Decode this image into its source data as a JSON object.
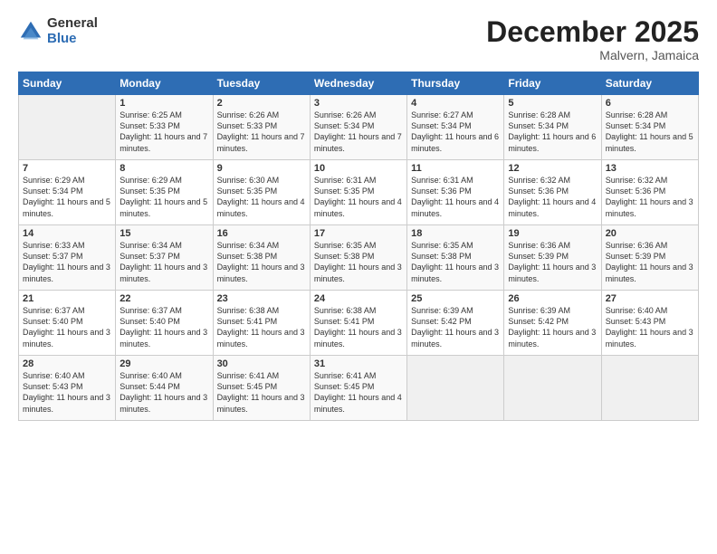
{
  "logo": {
    "general": "General",
    "blue": "Blue"
  },
  "header": {
    "month": "December 2025",
    "location": "Malvern, Jamaica"
  },
  "weekdays": [
    "Sunday",
    "Monday",
    "Tuesday",
    "Wednesday",
    "Thursday",
    "Friday",
    "Saturday"
  ],
  "weeks": [
    [
      {
        "day": "",
        "sunrise": "",
        "sunset": "",
        "daylight": ""
      },
      {
        "day": "1",
        "sunrise": "Sunrise: 6:25 AM",
        "sunset": "Sunset: 5:33 PM",
        "daylight": "Daylight: 11 hours and 7 minutes."
      },
      {
        "day": "2",
        "sunrise": "Sunrise: 6:26 AM",
        "sunset": "Sunset: 5:33 PM",
        "daylight": "Daylight: 11 hours and 7 minutes."
      },
      {
        "day": "3",
        "sunrise": "Sunrise: 6:26 AM",
        "sunset": "Sunset: 5:34 PM",
        "daylight": "Daylight: 11 hours and 7 minutes."
      },
      {
        "day": "4",
        "sunrise": "Sunrise: 6:27 AM",
        "sunset": "Sunset: 5:34 PM",
        "daylight": "Daylight: 11 hours and 6 minutes."
      },
      {
        "day": "5",
        "sunrise": "Sunrise: 6:28 AM",
        "sunset": "Sunset: 5:34 PM",
        "daylight": "Daylight: 11 hours and 6 minutes."
      },
      {
        "day": "6",
        "sunrise": "Sunrise: 6:28 AM",
        "sunset": "Sunset: 5:34 PM",
        "daylight": "Daylight: 11 hours and 5 minutes."
      }
    ],
    [
      {
        "day": "7",
        "sunrise": "Sunrise: 6:29 AM",
        "sunset": "Sunset: 5:34 PM",
        "daylight": "Daylight: 11 hours and 5 minutes."
      },
      {
        "day": "8",
        "sunrise": "Sunrise: 6:29 AM",
        "sunset": "Sunset: 5:35 PM",
        "daylight": "Daylight: 11 hours and 5 minutes."
      },
      {
        "day": "9",
        "sunrise": "Sunrise: 6:30 AM",
        "sunset": "Sunset: 5:35 PM",
        "daylight": "Daylight: 11 hours and 4 minutes."
      },
      {
        "day": "10",
        "sunrise": "Sunrise: 6:31 AM",
        "sunset": "Sunset: 5:35 PM",
        "daylight": "Daylight: 11 hours and 4 minutes."
      },
      {
        "day": "11",
        "sunrise": "Sunrise: 6:31 AM",
        "sunset": "Sunset: 5:36 PM",
        "daylight": "Daylight: 11 hours and 4 minutes."
      },
      {
        "day": "12",
        "sunrise": "Sunrise: 6:32 AM",
        "sunset": "Sunset: 5:36 PM",
        "daylight": "Daylight: 11 hours and 4 minutes."
      },
      {
        "day": "13",
        "sunrise": "Sunrise: 6:32 AM",
        "sunset": "Sunset: 5:36 PM",
        "daylight": "Daylight: 11 hours and 3 minutes."
      }
    ],
    [
      {
        "day": "14",
        "sunrise": "Sunrise: 6:33 AM",
        "sunset": "Sunset: 5:37 PM",
        "daylight": "Daylight: 11 hours and 3 minutes."
      },
      {
        "day": "15",
        "sunrise": "Sunrise: 6:34 AM",
        "sunset": "Sunset: 5:37 PM",
        "daylight": "Daylight: 11 hours and 3 minutes."
      },
      {
        "day": "16",
        "sunrise": "Sunrise: 6:34 AM",
        "sunset": "Sunset: 5:38 PM",
        "daylight": "Daylight: 11 hours and 3 minutes."
      },
      {
        "day": "17",
        "sunrise": "Sunrise: 6:35 AM",
        "sunset": "Sunset: 5:38 PM",
        "daylight": "Daylight: 11 hours and 3 minutes."
      },
      {
        "day": "18",
        "sunrise": "Sunrise: 6:35 AM",
        "sunset": "Sunset: 5:38 PM",
        "daylight": "Daylight: 11 hours and 3 minutes."
      },
      {
        "day": "19",
        "sunrise": "Sunrise: 6:36 AM",
        "sunset": "Sunset: 5:39 PM",
        "daylight": "Daylight: 11 hours and 3 minutes."
      },
      {
        "day": "20",
        "sunrise": "Sunrise: 6:36 AM",
        "sunset": "Sunset: 5:39 PM",
        "daylight": "Daylight: 11 hours and 3 minutes."
      }
    ],
    [
      {
        "day": "21",
        "sunrise": "Sunrise: 6:37 AM",
        "sunset": "Sunset: 5:40 PM",
        "daylight": "Daylight: 11 hours and 3 minutes."
      },
      {
        "day": "22",
        "sunrise": "Sunrise: 6:37 AM",
        "sunset": "Sunset: 5:40 PM",
        "daylight": "Daylight: 11 hours and 3 minutes."
      },
      {
        "day": "23",
        "sunrise": "Sunrise: 6:38 AM",
        "sunset": "Sunset: 5:41 PM",
        "daylight": "Daylight: 11 hours and 3 minutes."
      },
      {
        "day": "24",
        "sunrise": "Sunrise: 6:38 AM",
        "sunset": "Sunset: 5:41 PM",
        "daylight": "Daylight: 11 hours and 3 minutes."
      },
      {
        "day": "25",
        "sunrise": "Sunrise: 6:39 AM",
        "sunset": "Sunset: 5:42 PM",
        "daylight": "Daylight: 11 hours and 3 minutes."
      },
      {
        "day": "26",
        "sunrise": "Sunrise: 6:39 AM",
        "sunset": "Sunset: 5:42 PM",
        "daylight": "Daylight: 11 hours and 3 minutes."
      },
      {
        "day": "27",
        "sunrise": "Sunrise: 6:40 AM",
        "sunset": "Sunset: 5:43 PM",
        "daylight": "Daylight: 11 hours and 3 minutes."
      }
    ],
    [
      {
        "day": "28",
        "sunrise": "Sunrise: 6:40 AM",
        "sunset": "Sunset: 5:43 PM",
        "daylight": "Daylight: 11 hours and 3 minutes."
      },
      {
        "day": "29",
        "sunrise": "Sunrise: 6:40 AM",
        "sunset": "Sunset: 5:44 PM",
        "daylight": "Daylight: 11 hours and 3 minutes."
      },
      {
        "day": "30",
        "sunrise": "Sunrise: 6:41 AM",
        "sunset": "Sunset: 5:45 PM",
        "daylight": "Daylight: 11 hours and 3 minutes."
      },
      {
        "day": "31",
        "sunrise": "Sunrise: 6:41 AM",
        "sunset": "Sunset: 5:45 PM",
        "daylight": "Daylight: 11 hours and 4 minutes."
      },
      {
        "day": "",
        "sunrise": "",
        "sunset": "",
        "daylight": ""
      },
      {
        "day": "",
        "sunrise": "",
        "sunset": "",
        "daylight": ""
      },
      {
        "day": "",
        "sunrise": "",
        "sunset": "",
        "daylight": ""
      }
    ]
  ]
}
